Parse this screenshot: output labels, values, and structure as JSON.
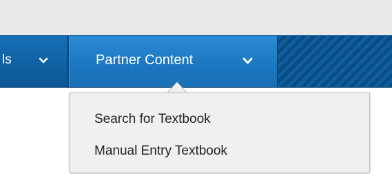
{
  "nav": {
    "tabs": [
      {
        "label": "ls"
      },
      {
        "label": "Partner Content"
      }
    ]
  },
  "dropdown": {
    "items": [
      {
        "label": "Search for Textbook"
      },
      {
        "label": "Manual Entry Textbook"
      }
    ]
  },
  "icons": {
    "chevron": "chevron-down-icon",
    "caret": "menu-caret-icon"
  },
  "colors": {
    "nav_background": "#0a4d83",
    "active_tab": "#1a76bf",
    "dropdown_background": "#f0f0f0",
    "menu_text": "#222222"
  }
}
